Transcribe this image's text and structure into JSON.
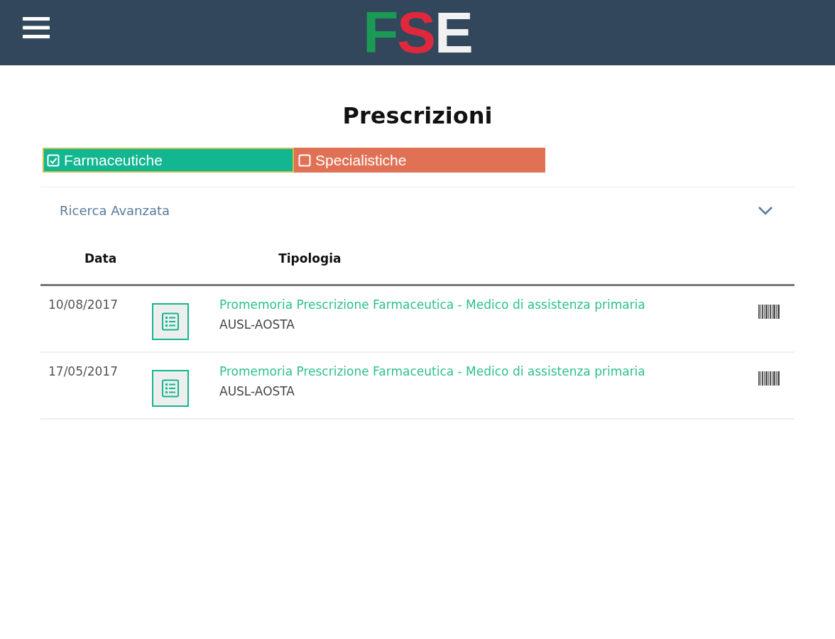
{
  "header": {
    "logo": "FSE"
  },
  "title": "Prescrizioni",
  "filters": [
    {
      "label": "Farmaceutiche",
      "checked": true,
      "color": "#12b690"
    },
    {
      "label": "Specialistiche",
      "checked": false,
      "color": "#e07155"
    }
  ],
  "advanced_search": {
    "label": "Ricerca Avanzata",
    "expanded": false
  },
  "table": {
    "columns": [
      "Data",
      "Tipologia"
    ],
    "rows": [
      {
        "date": "10/08/2017",
        "title": "Promemoria Prescrizione Farmaceutica - Medico di assistenza primaria",
        "issuer": "AUSL-AOSTA"
      },
      {
        "date": "17/05/2017",
        "title": "Promemoria Prescrizione Farmaceutica - Medico di assistenza primaria",
        "issuer": "AUSL-AOSTA"
      }
    ]
  }
}
